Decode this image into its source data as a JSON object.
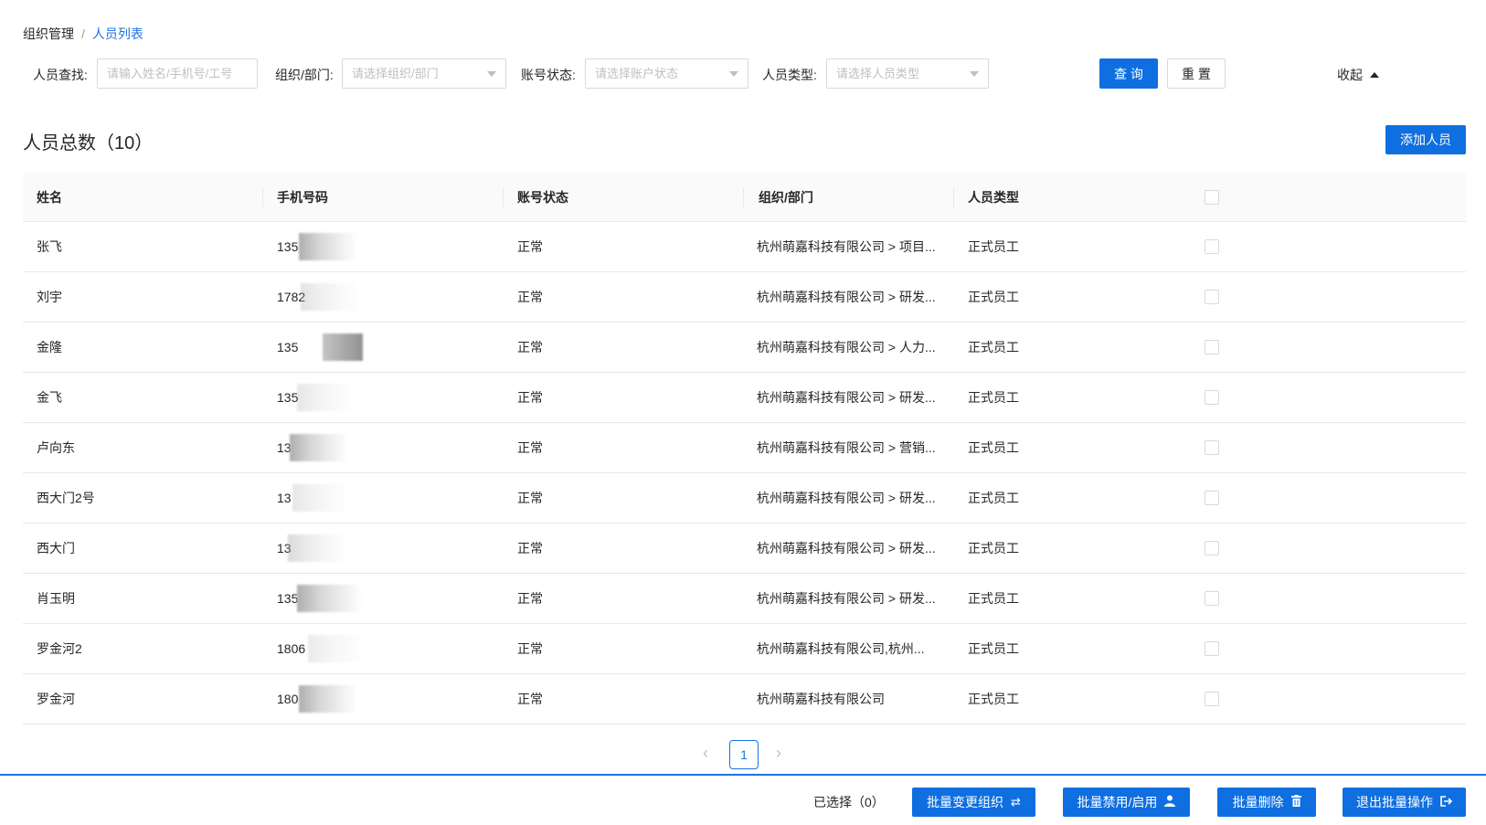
{
  "breadcrumb": {
    "root": "组织管理",
    "separator": "/",
    "current": "人员列表"
  },
  "filters": {
    "person_label": "人员查找:",
    "person_placeholder": "请输入姓名/手机号/工号",
    "org_label": "组织/部门:",
    "org_placeholder": "请选择组织/部门",
    "status_label": "账号状态:",
    "status_placeholder": "请选择账户状态",
    "type_label": "人员类型:",
    "type_placeholder": "请选择人员类型",
    "query_button": "查 询",
    "reset_button": "重 置",
    "collapse_label": "收起"
  },
  "summary": {
    "title": "人员总数（10）",
    "add_button": "添加人员"
  },
  "table": {
    "columns": [
      "姓名",
      "手机号码",
      "账号状态",
      "组织/部门",
      "人员类型"
    ],
    "rows": [
      {
        "name": "张飞",
        "phone": "135",
        "status": "正常",
        "org": "杭州萌嘉科技有限公司 > 项目...",
        "type": "正式员工"
      },
      {
        "name": "刘宇",
        "phone": "1782",
        "status": "正常",
        "org": "杭州萌嘉科技有限公司 > 研发...",
        "type": "正式员工"
      },
      {
        "name": "金隆",
        "phone": "135",
        "status": "正常",
        "org": "杭州萌嘉科技有限公司 > 人力...",
        "type": "正式员工"
      },
      {
        "name": "金飞",
        "phone": "135",
        "status": "正常",
        "org": "杭州萌嘉科技有限公司 > 研发...",
        "type": "正式员工"
      },
      {
        "name": "卢向东",
        "phone": "13",
        "status": "正常",
        "org": "杭州萌嘉科技有限公司 > 营销...",
        "type": "正式员工"
      },
      {
        "name": "西大门2号",
        "phone": "13",
        "status": "正常",
        "org": "杭州萌嘉科技有限公司 > 研发...",
        "type": "正式员工"
      },
      {
        "name": "西大门",
        "phone": "13",
        "status": "正常",
        "org": "杭州萌嘉科技有限公司 > 研发...",
        "type": "正式员工"
      },
      {
        "name": "肖玉明",
        "phone": "135",
        "status": "正常",
        "org": "杭州萌嘉科技有限公司 > 研发...",
        "type": "正式员工"
      },
      {
        "name": "罗金河2",
        "phone": "1806",
        "status": "正常",
        "org": "杭州萌嘉科技有限公司,杭州...",
        "type": "正式员工"
      },
      {
        "name": "罗金河",
        "phone": "180",
        "status": "正常",
        "org": "杭州萌嘉科技有限公司",
        "type": "正式员工"
      }
    ]
  },
  "pagination": {
    "prev": "‹",
    "current_page": "1",
    "next": "›"
  },
  "footer": {
    "selected_label": "已选择（0）",
    "change_org_button": "批量变更组织",
    "toggle_button": "批量禁用/启用",
    "delete_button": "批量删除",
    "exit_button": "退出批量操作"
  },
  "colors": {
    "primary": "#0f6fe0",
    "link": "#1a73e8",
    "border": "#d9d9d9",
    "header_bg": "#fafafa"
  },
  "icons": {
    "change_org": "refresh-icon",
    "toggle": "user-icon",
    "delete": "trash-icon",
    "exit": "sign-out-icon",
    "collapse": "caret-up-icon",
    "select": "caret-down-icon"
  }
}
